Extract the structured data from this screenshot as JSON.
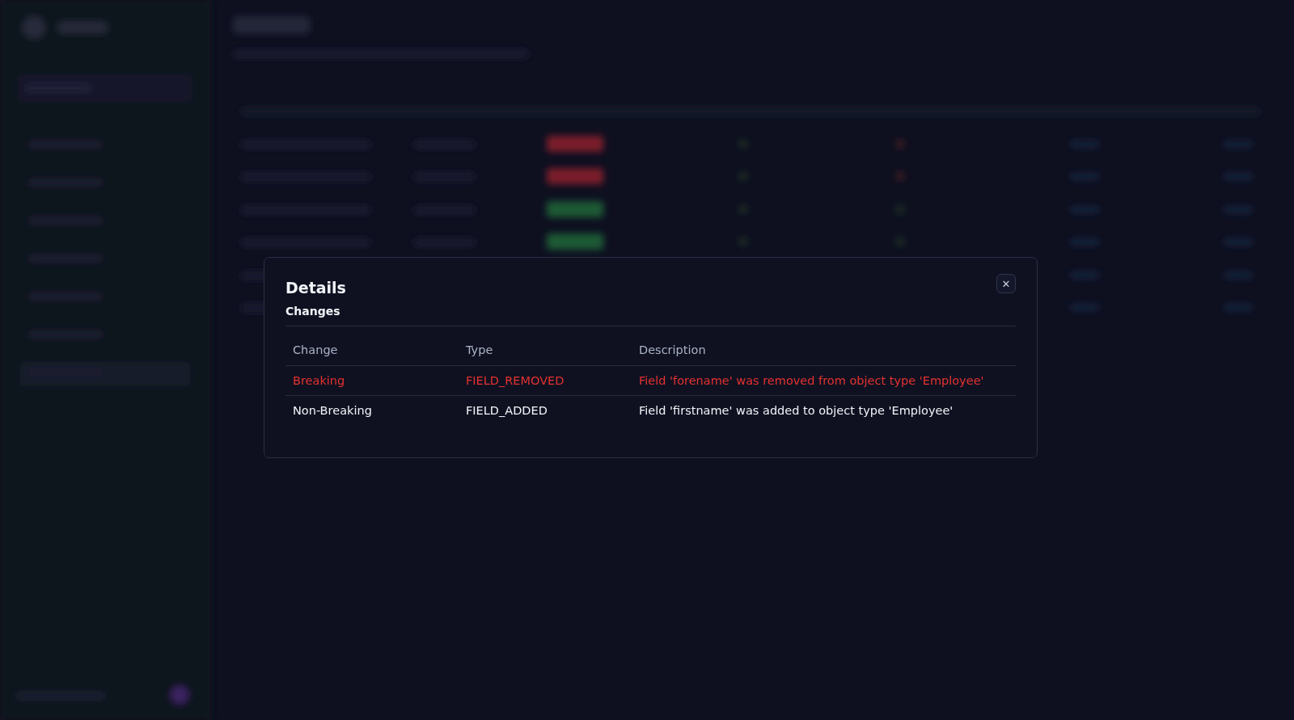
{
  "dialog": {
    "title": "Details",
    "close_label": "✕",
    "section": "Changes",
    "columns": [
      "Change",
      "Type",
      "Description"
    ],
    "rows": [
      {
        "breaking": true,
        "cells": [
          "Breaking",
          "FIELD_REMOVED",
          "Field 'forename' was removed from object type 'Employee'"
        ]
      },
      {
        "breaking": false,
        "cells": [
          "Non-Breaking",
          "FIELD_ADDED",
          "Field 'firstname' was added to object type 'Employee'"
        ]
      }
    ]
  }
}
